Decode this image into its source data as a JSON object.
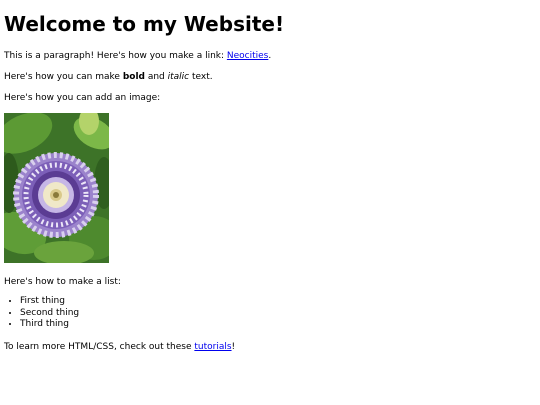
{
  "heading": "Welcome to my Website!",
  "paragraph1": {
    "text_before": "This is a paragraph! Here's how you make a link: ",
    "link_text": "Neocities",
    "text_after": "."
  },
  "paragraph2": {
    "text_before": "Here's how you can make ",
    "bold_text": "bold",
    "text_middle": " and ",
    "italic_text": "italic",
    "text_after": " text."
  },
  "paragraph3": "Here's how you can add an image:",
  "image": {
    "icon": "passion-flower-photo",
    "colors": {
      "leaf_dark": "#2f5f1f",
      "leaf_light": "#6fa63a",
      "petal": "#a58ad6",
      "center": "#f0e8c8"
    }
  },
  "list_intro": "Here's how to make a list:",
  "list_items": [
    "First thing",
    "Second thing",
    "Third thing"
  ],
  "closing": {
    "text_before": "To learn more HTML/CSS, check out these ",
    "link_text": "tutorials",
    "text_after": "!"
  }
}
